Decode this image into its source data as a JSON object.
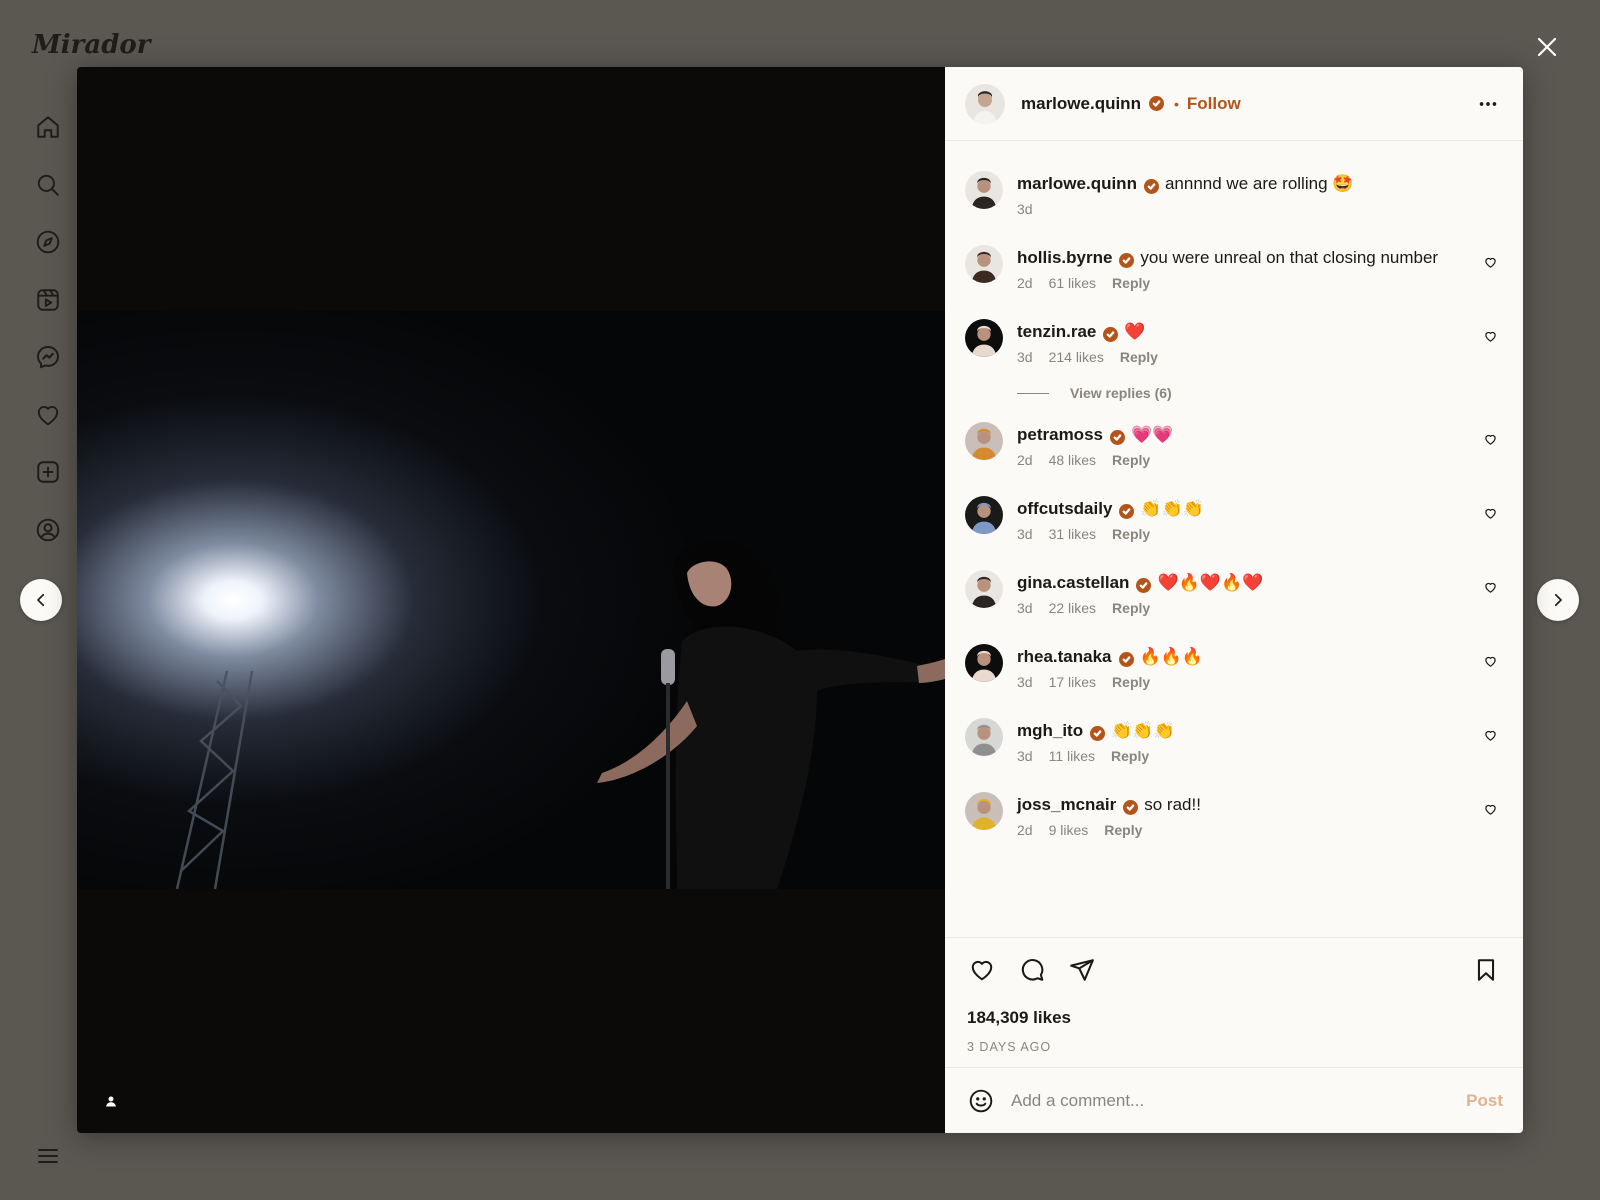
{
  "app": {
    "brand": "Mirador"
  },
  "sidebar": {
    "items": [
      {
        "name": "home",
        "icon": "home-icon"
      },
      {
        "name": "search",
        "icon": "search-icon"
      },
      {
        "name": "explore",
        "icon": "compass-icon"
      },
      {
        "name": "reels",
        "icon": "reels-icon"
      },
      {
        "name": "messages",
        "icon": "messenger-icon"
      },
      {
        "name": "notifications",
        "icon": "heart-icon"
      },
      {
        "name": "create",
        "icon": "plus-square-icon"
      },
      {
        "name": "profile",
        "icon": "profile-icon"
      }
    ],
    "menu_icon": "hamburger-icon"
  },
  "post": {
    "author": "marlowe.quinn",
    "follow_label": "Follow",
    "likes": "184,309 likes",
    "timestamp": "3 DAYS AGO",
    "accent": "#b3551a"
  },
  "comments": [
    {
      "user": "marlowe.quinn",
      "text": "annnnd we are rolling 🤩",
      "time": "3d",
      "likes": "",
      "reply": "",
      "avatar_bg": "#e9e6e1",
      "avatar_fg": "#2a2522",
      "likeable": false
    },
    {
      "user": "hollis.byrne",
      "text": "you were unreal on that closing number",
      "time": "2d",
      "likes": "61 likes",
      "reply": "Reply",
      "avatar_bg": "#e9e6e1",
      "avatar_fg": "#3a2a22",
      "likeable": true
    },
    {
      "user": "tenzin.rae",
      "text": "❤️",
      "time": "3d",
      "likes": "214 likes",
      "reply": "Reply",
      "avatar_bg": "#0d0d0d",
      "avatar_fg": "#e9d9cf",
      "likeable": true,
      "view_replies": "View replies (6)"
    },
    {
      "user": "petramoss",
      "text": "💗💗",
      "time": "2d",
      "likes": "48 likes",
      "reply": "Reply",
      "avatar_bg": "#c9bfb8",
      "avatar_fg": "#d6892e",
      "likeable": true
    },
    {
      "user": "offcutsdaily",
      "text": "👏👏👏",
      "time": "3d",
      "likes": "31 likes",
      "reply": "Reply",
      "avatar_bg": "#1a1a1a",
      "avatar_fg": "#7d99c6",
      "likeable": true
    },
    {
      "user": "gina.castellan",
      "text": "❤️🔥❤️🔥❤️",
      "time": "3d",
      "likes": "22 likes",
      "reply": "Reply",
      "avatar_bg": "#e9e6e1",
      "avatar_fg": "#2a2522",
      "likeable": true
    },
    {
      "user": "rhea.tanaka",
      "text": "🔥🔥🔥",
      "time": "3d",
      "likes": "17 likes",
      "reply": "Reply",
      "avatar_bg": "#0d0d0d",
      "avatar_fg": "#e9d9cf",
      "likeable": true
    },
    {
      "user": "mgh_ito",
      "text": "👏👏👏",
      "time": "3d",
      "likes": "11 likes",
      "reply": "Reply",
      "avatar_bg": "#d7d7d5",
      "avatar_fg": "#8f8f8f",
      "likeable": true
    },
    {
      "user": "joss_mcnair",
      "text": "so rad!!",
      "time": "2d",
      "likes": "9 likes",
      "reply": "Reply",
      "avatar_bg": "#c9bfb8",
      "avatar_fg": "#e0b12b",
      "likeable": true
    }
  ],
  "composer": {
    "placeholder": "Add a comment...",
    "post_label": "Post"
  }
}
